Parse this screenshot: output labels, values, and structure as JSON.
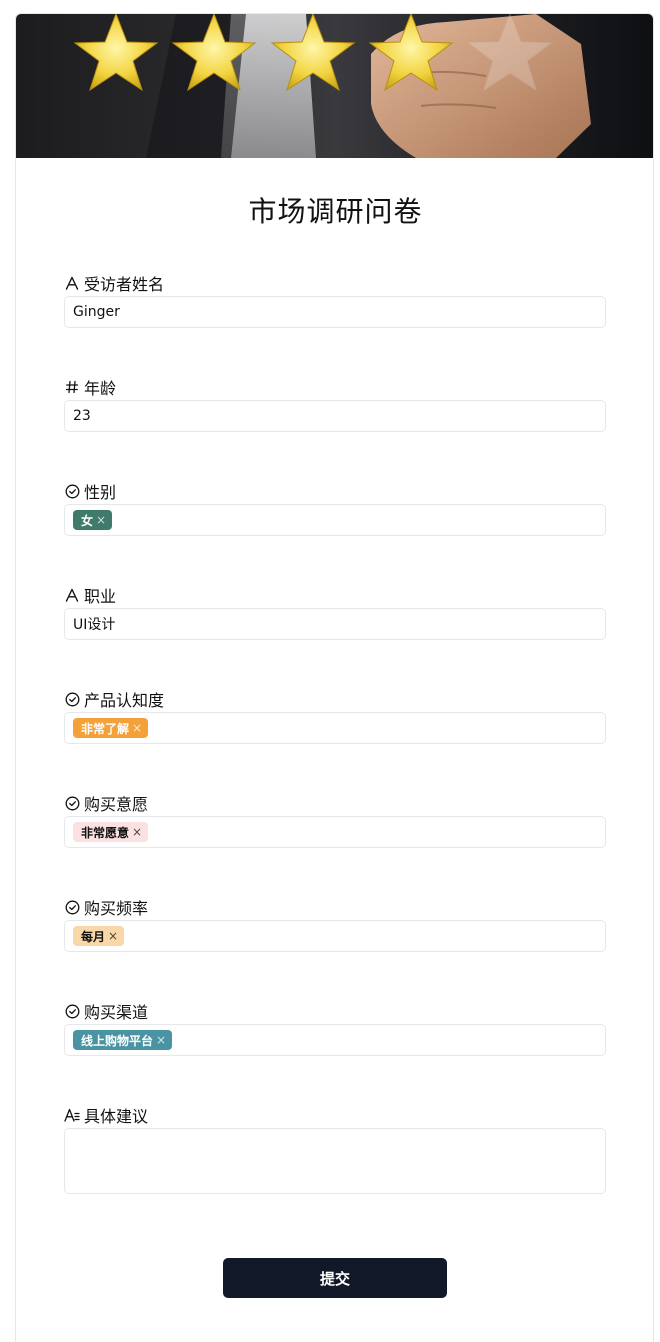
{
  "form": {
    "title": "市场调研问卷",
    "submit_label": "提交"
  },
  "fields": {
    "name": {
      "label": "受访者姓名",
      "icon": "text-icon",
      "value": "Ginger"
    },
    "age": {
      "label": "年龄",
      "icon": "hash-icon",
      "value": "23"
    },
    "gender": {
      "label": "性别",
      "icon": "check-circle-icon",
      "tag": "女",
      "tag_bg": "#3f7a6b",
      "tag_fg": "#ffffff"
    },
    "job": {
      "label": "职业",
      "icon": "text-icon",
      "value": "UI设计"
    },
    "awareness": {
      "label": "产品认知度",
      "icon": "check-circle-icon",
      "tag": "非常了解",
      "tag_bg": "#f3a23a",
      "tag_fg": "#ffffff"
    },
    "intent": {
      "label": "购买意愿",
      "icon": "check-circle-icon",
      "tag": "非常愿意",
      "tag_bg": "#fbe1e1",
      "tag_fg": "#111111"
    },
    "frequency": {
      "label": "购买频率",
      "icon": "check-circle-icon",
      "tag": "每月",
      "tag_bg": "#f9d7a8",
      "tag_fg": "#111111"
    },
    "channel": {
      "label": "购买渠道",
      "icon": "check-circle-icon",
      "tag": "线上购物平台",
      "tag_bg": "#4a93a3",
      "tag_fg": "#ffffff"
    },
    "advice": {
      "label": "具体建议",
      "icon": "long-text-icon",
      "value": ""
    }
  },
  "tag_remove_glyph": "×"
}
